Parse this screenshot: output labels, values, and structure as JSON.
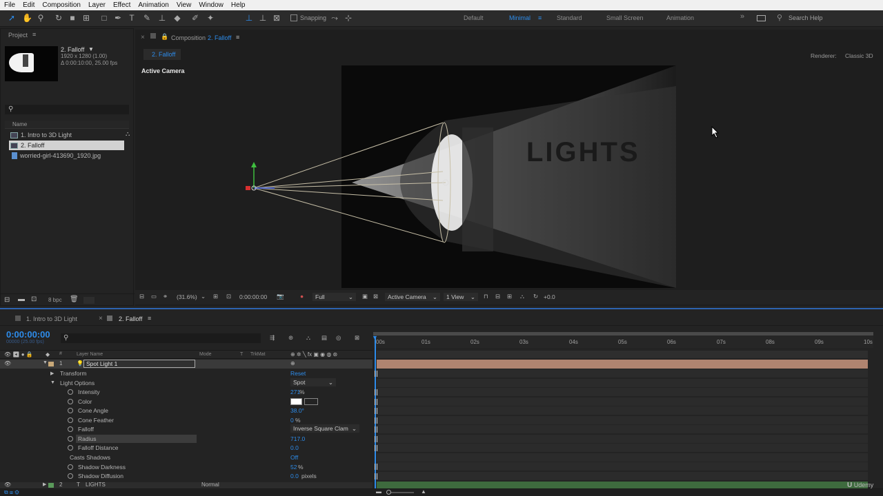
{
  "menubar": [
    "File",
    "Edit",
    "Composition",
    "Layer",
    "Effect",
    "Animation",
    "View",
    "Window",
    "Help"
  ],
  "toolbar": {
    "snapping_label": "Snapping",
    "workspaces": [
      "Default",
      "Minimal",
      "Standard",
      "Small Screen",
      "Animation"
    ],
    "active_workspace": "Minimal",
    "search_placeholder": "Search Help"
  },
  "project": {
    "panel_title": "Project",
    "selected_name": "2. Falloff",
    "selected_dims": "1920 x 1280 (1.00)",
    "selected_duration": "Δ 0:00:10:00, 25.00 fps",
    "column_name": "Name",
    "items": [
      {
        "name": "1. Intro to 3D Light",
        "type": "comp"
      },
      {
        "name": "2. Falloff",
        "type": "comp",
        "selected": true
      },
      {
        "name": "worried-girl-413690_1920.jpg",
        "type": "file"
      }
    ],
    "bpc": "8 bpc"
  },
  "composition": {
    "panel_label": "Composition",
    "comp_name": "2. Falloff",
    "tab_label": "2. Falloff",
    "renderer_label": "Renderer:",
    "renderer_value": "Classic 3D",
    "view_label": "Active Camera",
    "image_text": "LIGHTS"
  },
  "viewer_bar": {
    "zoom": "(31.6%)",
    "timecode": "0:00:00:00",
    "resolution": "Full",
    "camera": "Active Camera",
    "views": "1 View",
    "exposure": "+0.0"
  },
  "timeline": {
    "tabs": [
      "1. Intro to 3D Light",
      "2. Falloff"
    ],
    "timecode": "0:00:00:00",
    "fps_sub": "00000 (25.00 fps)",
    "columns": {
      "layer_name": "Layer Name",
      "mode": "Mode",
      "t": "T",
      "trkmat": "TrkMat"
    },
    "ruler": [
      "00s",
      "01s",
      "02s",
      "03s",
      "04s",
      "05s",
      "06s",
      "07s",
      "08s",
      "09s",
      "10s"
    ],
    "layer1": {
      "num": "1",
      "name": "Spot Light 1"
    },
    "layer2": {
      "num": "2",
      "name": "LIGHTS",
      "mode": "Normal"
    },
    "transform": {
      "label": "Transform",
      "value": "Reset"
    },
    "light_options": {
      "label": "Light Options",
      "value": "Spot"
    },
    "props": [
      {
        "label": "Intensity",
        "value": "271",
        "unit": "%"
      },
      {
        "label": "Color",
        "value": "",
        "unit": ""
      },
      {
        "label": "Cone Angle",
        "value": "38.0°",
        "unit": ""
      },
      {
        "label": "Cone Feather",
        "value": "0",
        "unit": "%"
      },
      {
        "label": "Falloff",
        "value": "Inverse Square Clam",
        "unit": ""
      },
      {
        "label": "Radius",
        "value": "717.0",
        "unit": ""
      },
      {
        "label": "Falloff Distance",
        "value": "0.0",
        "unit": ""
      },
      {
        "label": "Casts Shadows",
        "value": "Off",
        "unit": ""
      },
      {
        "label": "Shadow Darkness",
        "value": "52",
        "unit": "%"
      },
      {
        "label": "Shadow Diffusion",
        "value": "0.0",
        "unit": "pixels"
      }
    ]
  },
  "watermark": "Udemy"
}
